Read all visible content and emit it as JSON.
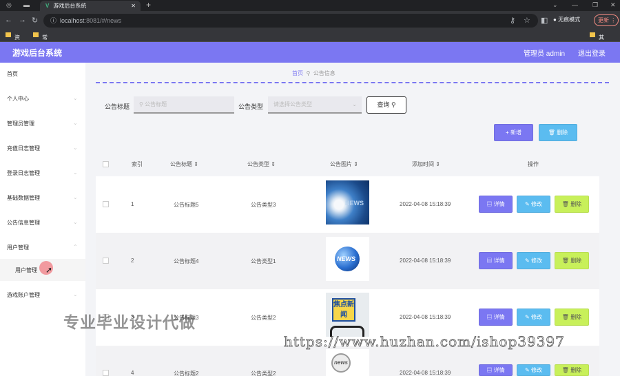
{
  "browser": {
    "tab_title": "游戏后台系统",
    "url_host": "localhost",
    "url_rest": ":8081/#/news",
    "incognito_label": "无痕模式",
    "update_label": "更新",
    "bookmarks": [
      "资料",
      "常用"
    ],
    "bookmarks_right": "其他书签"
  },
  "header": {
    "title": "游戏后台系统",
    "user": "管理员 admin",
    "logout": "退出登录"
  },
  "sidebar": {
    "items": [
      "首页",
      "个人中心",
      "管理员管理",
      "充值日志管理",
      "登录日志管理",
      "基础数据管理",
      "公告信息管理",
      "用户管理"
    ],
    "sub_item": "用户管理",
    "last_item": "游戏账户管理"
  },
  "breadcrumb": {
    "home": "首页",
    "current": "公告信息"
  },
  "filter": {
    "title_label": "公告标题",
    "title_placeholder": "公告标题",
    "type_label": "公告类型",
    "type_placeholder": "请选择公告类型",
    "search_button": "查询"
  },
  "actions": {
    "add": "新增",
    "delete": "删除"
  },
  "table": {
    "columns": [
      "索引",
      "公告标题",
      "公告类型",
      "公告图片",
      "添加时间",
      "操作"
    ],
    "rows": [
      {
        "index": "1",
        "title": "公告标题5",
        "type": "公告类型3",
        "time": "2022-04-08 15:18:39",
        "img_text": "NEWS"
      },
      {
        "index": "2",
        "title": "公告标题4",
        "type": "公告类型1",
        "time": "2022-04-08 15:18:39",
        "img_text": "NEWS"
      },
      {
        "index": "3",
        "title": "公告标题3",
        "type": "公告类型2",
        "time": "2022-04-08 15:18:39",
        "img_text": "焦点新闻"
      },
      {
        "index": "4",
        "title": "公告标题2",
        "type": "公告类型2",
        "time": "2022-04-08 15:18:39",
        "img_text": "news"
      }
    ],
    "btn_detail": "详情",
    "btn_edit": "修改",
    "btn_delete": "删除"
  },
  "watermark": {
    "cn": "专业毕业设计代做",
    "url": "https://www.huzhan.com/ishop39397"
  },
  "colors": {
    "primary": "#7b77f2",
    "info": "#5bbcf0",
    "lime": "#c8f05a"
  }
}
